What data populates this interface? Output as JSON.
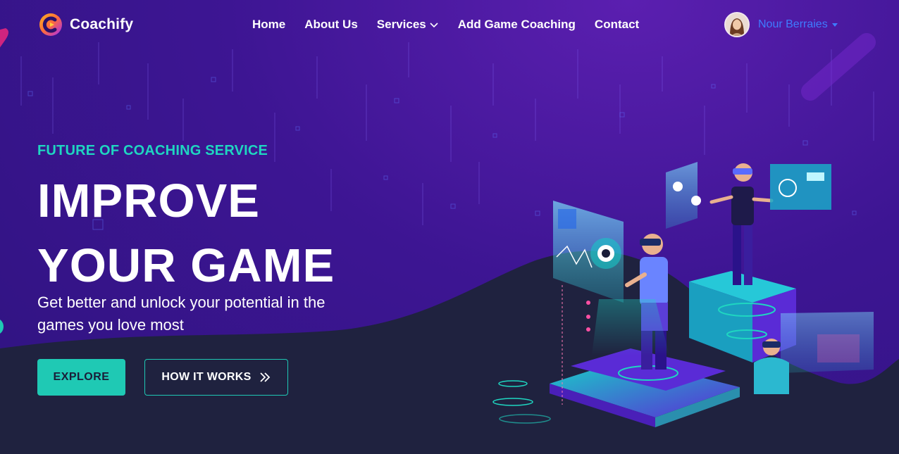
{
  "brand": {
    "name": "Coachify",
    "logo_icon": "c-logo-icon"
  },
  "nav": {
    "items": [
      {
        "label": "Home"
      },
      {
        "label": "About Us"
      },
      {
        "label": "Services",
        "icon": "chevron-down-icon"
      },
      {
        "label": "Add Game Coaching"
      },
      {
        "label": "Contact"
      }
    ]
  },
  "user": {
    "name": "Nour Berraies",
    "avatar_icon": "avatar",
    "menu_icon": "caret-down-icon"
  },
  "hero": {
    "eyebrow": "FUTURE OF COACHING SERVICE",
    "title_line1": "IMPROVE",
    "title_line2": "YOUR GAME",
    "subtitle": "Get better and unlock your potential in the games you love most",
    "explore_label": "EXPLORE",
    "how_label": "HOW IT WORKS",
    "how_icon": "double-chevron-right-icon"
  },
  "colors": {
    "accent": "#1fc9b4",
    "bg_purple": "#3d1593",
    "bg_dark": "#1e2140",
    "user_link": "#3e7cff"
  }
}
